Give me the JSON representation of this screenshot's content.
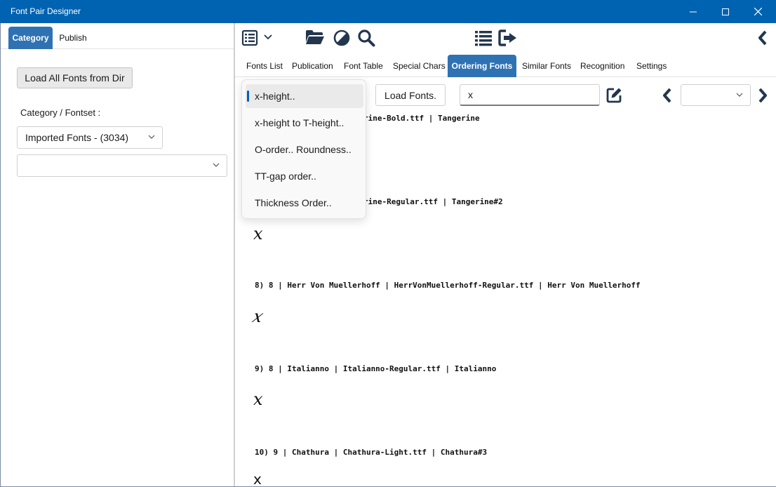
{
  "window": {
    "title": "Font Pair Designer"
  },
  "left_panel": {
    "tabs": [
      {
        "label": "Category",
        "active": true
      },
      {
        "label": "Publish",
        "active": false
      }
    ],
    "load_button_label": "Load All Fonts from Dir",
    "category_label": "Category / Fontset :",
    "fontset_select_value": "Imported Fonts - (3034)",
    "second_select_value": ""
  },
  "toolbar": {
    "icons": [
      "list-view-icon",
      "chevron-down-icon",
      "folder-open-icon",
      "contrast-icon",
      "search-icon",
      "list-icon",
      "exit-icon",
      "collapse-left-icon"
    ]
  },
  "tabs": [
    {
      "label": "Fonts List",
      "active": false
    },
    {
      "label": "Publication",
      "active": false
    },
    {
      "label": "Font Table",
      "active": false
    },
    {
      "label": "Special Chars",
      "active": false
    },
    {
      "label": "Ordering Fonts",
      "active": true
    },
    {
      "label": "Similar Fonts",
      "active": false
    },
    {
      "label": "Recognition",
      "active": false
    },
    {
      "label": "Settings",
      "active": false
    }
  ],
  "ordering": {
    "load_fonts_label": "Load Fonts.",
    "search_value": "x",
    "page_select_value": ""
  },
  "dropdown": {
    "items": [
      {
        "label": "x-height..",
        "selected": true
      },
      {
        "label": "x-height to T-height..",
        "selected": false
      },
      {
        "label": "O-order.. Roundness..",
        "selected": false
      },
      {
        "label": "TT-gap order..",
        "selected": false
      },
      {
        "label": "Thickness Order..",
        "selected": false
      }
    ]
  },
  "results": [
    {
      "line": "rine-Bold.ttf | Tangerine",
      "sample": ""
    },
    {
      "line": "rine-Regular.ttf | Tangerine#2",
      "sample": "x"
    },
    {
      "line": "8) 8 | Herr Von Muellerhoff | HerrVonMuellerhoff-Regular.ttf | Herr Von Muellerhoff",
      "sample": "x"
    },
    {
      "line": "9) 8 | Italianno | Italianno-Regular.ttf | Italianno",
      "sample": "x"
    },
    {
      "line": "10) 9 | Chathura | Chathura-Light.ttf | Chathura#3",
      "sample": "x"
    }
  ],
  "colors": {
    "titlebar": "#0063b1",
    "active_tab": "#2f72b3",
    "icon": "#22364e",
    "selection_accent": "#005fb8"
  }
}
